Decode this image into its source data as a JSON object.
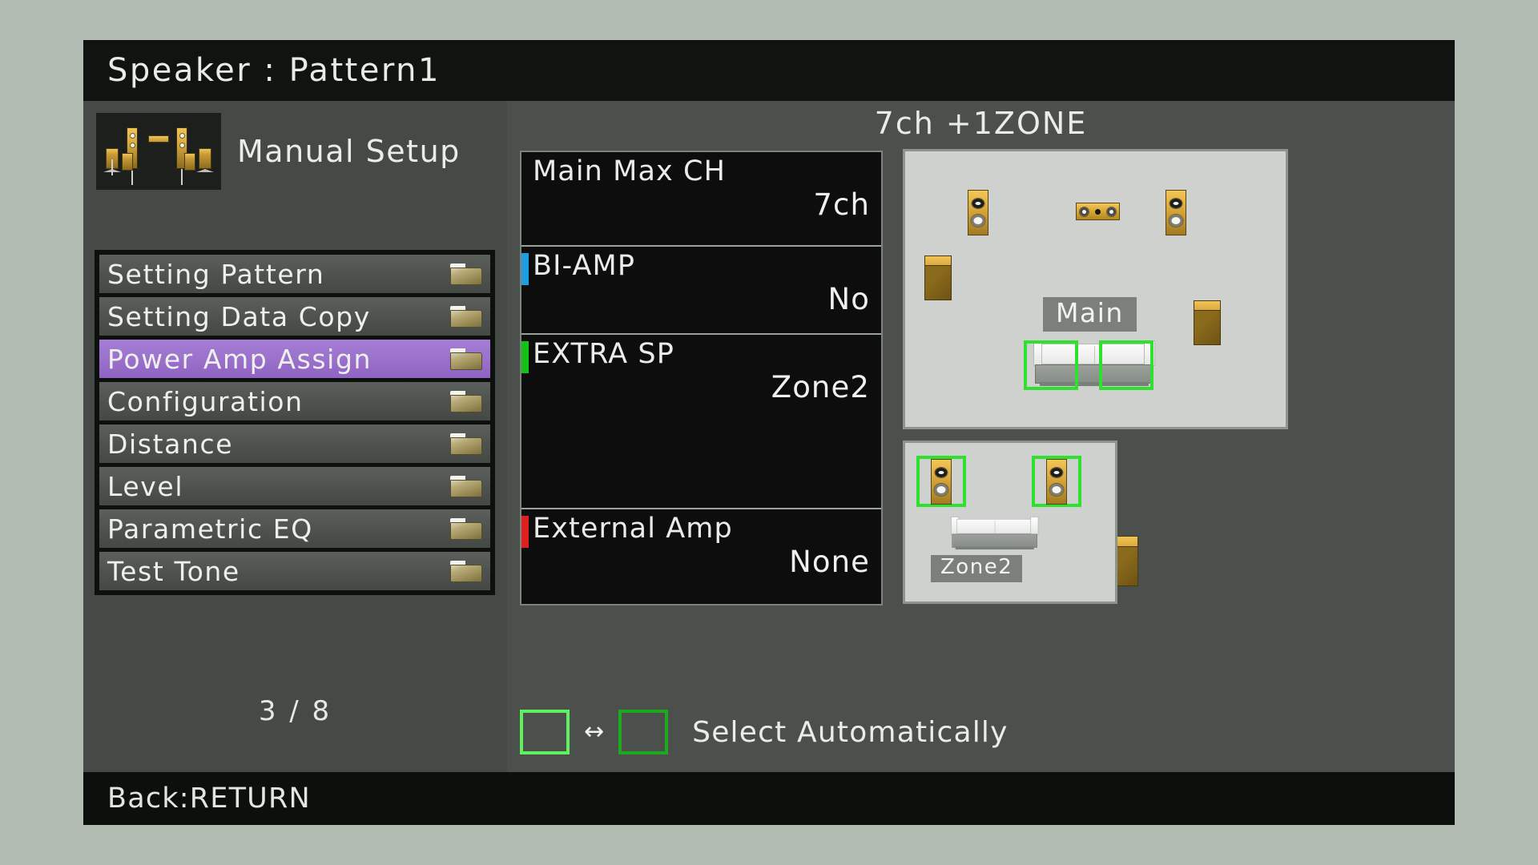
{
  "header": {
    "title": "Speaker : Pattern1"
  },
  "footer": {
    "back_hint": "Back:RETURN"
  },
  "sidebar": {
    "brand_label": "Manual Setup",
    "brand_icon": "speaker-layout-icon",
    "page_indicator": "3 / 8",
    "items": [
      {
        "label": "Setting Pattern",
        "icon": "folder-icon",
        "selected": false
      },
      {
        "label": "Setting Data Copy",
        "icon": "folder-icon",
        "selected": false
      },
      {
        "label": "Power Amp Assign",
        "icon": "folder-icon",
        "selected": true
      },
      {
        "label": "Configuration",
        "icon": "folder-icon",
        "selected": false
      },
      {
        "label": "Distance",
        "icon": "folder-icon",
        "selected": false
      },
      {
        "label": "Level",
        "icon": "folder-icon",
        "selected": false
      },
      {
        "label": "Parametric EQ",
        "icon": "folder-icon",
        "selected": false
      },
      {
        "label": "Test Tone",
        "icon": "folder-icon",
        "selected": false
      }
    ],
    "selected_highlight_color": "#9a70cb"
  },
  "main": {
    "assign_summary": "7ch +1ZONE",
    "settings": [
      {
        "name": "Main Max CH",
        "value": "7ch",
        "tag_color": "transparent"
      },
      {
        "name": "BI-AMP",
        "value": "No",
        "tag_color": "#1e9ee0"
      },
      {
        "name": "EXTRA SP",
        "value": "Zone2",
        "tag_color": "#17c017"
      },
      {
        "name": "External Amp",
        "value": "None",
        "tag_color": "#e01f1f"
      }
    ],
    "diagram_main": {
      "label": "Main",
      "speakers": [
        {
          "id": "front-left",
          "type": "tower",
          "highlighted": false
        },
        {
          "id": "center",
          "type": "center",
          "highlighted": false
        },
        {
          "id": "front-right",
          "type": "tower",
          "highlighted": false
        },
        {
          "id": "surround-left",
          "type": "box",
          "highlighted": false
        },
        {
          "id": "surround-right",
          "type": "box",
          "highlighted": false
        },
        {
          "id": "surround-back-left",
          "type": "box",
          "highlighted": true
        },
        {
          "id": "surround-back-right",
          "type": "box",
          "highlighted": true
        }
      ]
    },
    "diagram_zone": {
      "label": "Zone2",
      "speakers": [
        {
          "id": "zone2-left",
          "type": "tower",
          "highlighted": true
        },
        {
          "id": "zone2-right",
          "type": "tower",
          "highlighted": true
        }
      ]
    },
    "legend": {
      "box1_color": "#5ef05e",
      "box2_color": "#1ea81e",
      "arrow_glyph": "↔",
      "text": "Select Automatically"
    }
  }
}
